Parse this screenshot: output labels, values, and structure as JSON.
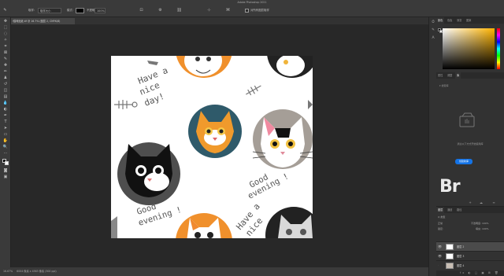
{
  "app": {
    "title": "Adobe Photoshop 2021"
  },
  "options_bar": {
    "sample_label": "取样:",
    "sample_value": "取样大小",
    "mode_label": "模式:",
    "opacity_label": "不透明度:",
    "opacity_value": "100%",
    "checkbox_label": "对所有图层取样"
  },
  "document": {
    "tab_title": "猫咪贴纸.tif @ 16.7% (图层 2, CMYK/8)",
    "close_glyph": "×"
  },
  "status_bar": {
    "zoom": "16.67%",
    "doc_info": "6004 像素 x 4563 像素 (300 ppi)"
  },
  "panels": {
    "top_tabs": [
      "颜色",
      "色板",
      "渐变",
      "图案"
    ],
    "mid_tabs": [
      "属性",
      "调整",
      "库"
    ],
    "library_search": "▾ 搜索库",
    "library_empty": "通过以下方式开始使用库",
    "library_button": "创建新库",
    "library_logo": "Br",
    "layer_tabs": [
      "图层",
      "通道",
      "路径"
    ],
    "layer_filter": "Q 类型",
    "blend_mode": "正常",
    "layer_opacity": "不透明度: 100%",
    "lock_label": "锁定:",
    "layer_fill": "填充: 100%",
    "layers": [
      {
        "name": "图层 2",
        "visible": true,
        "selected": true
      },
      {
        "name": "图层 3",
        "visible": true,
        "selected": false
      },
      {
        "name": "图层 4",
        "visible": false,
        "selected": false
      }
    ],
    "layer_footer": "fx ◐ ▢ ▣ ⊞ 🗑"
  },
  "canvas_text": {
    "have_nice_day": "Have a nice day!",
    "good_evening": "Good evening !"
  },
  "colors": {
    "orange": "#f0902c",
    "teal": "#2f5a6a",
    "dark_gray": "#4e4e4e",
    "taupe": "#a59e97",
    "accent_blue": "#1473e6"
  }
}
